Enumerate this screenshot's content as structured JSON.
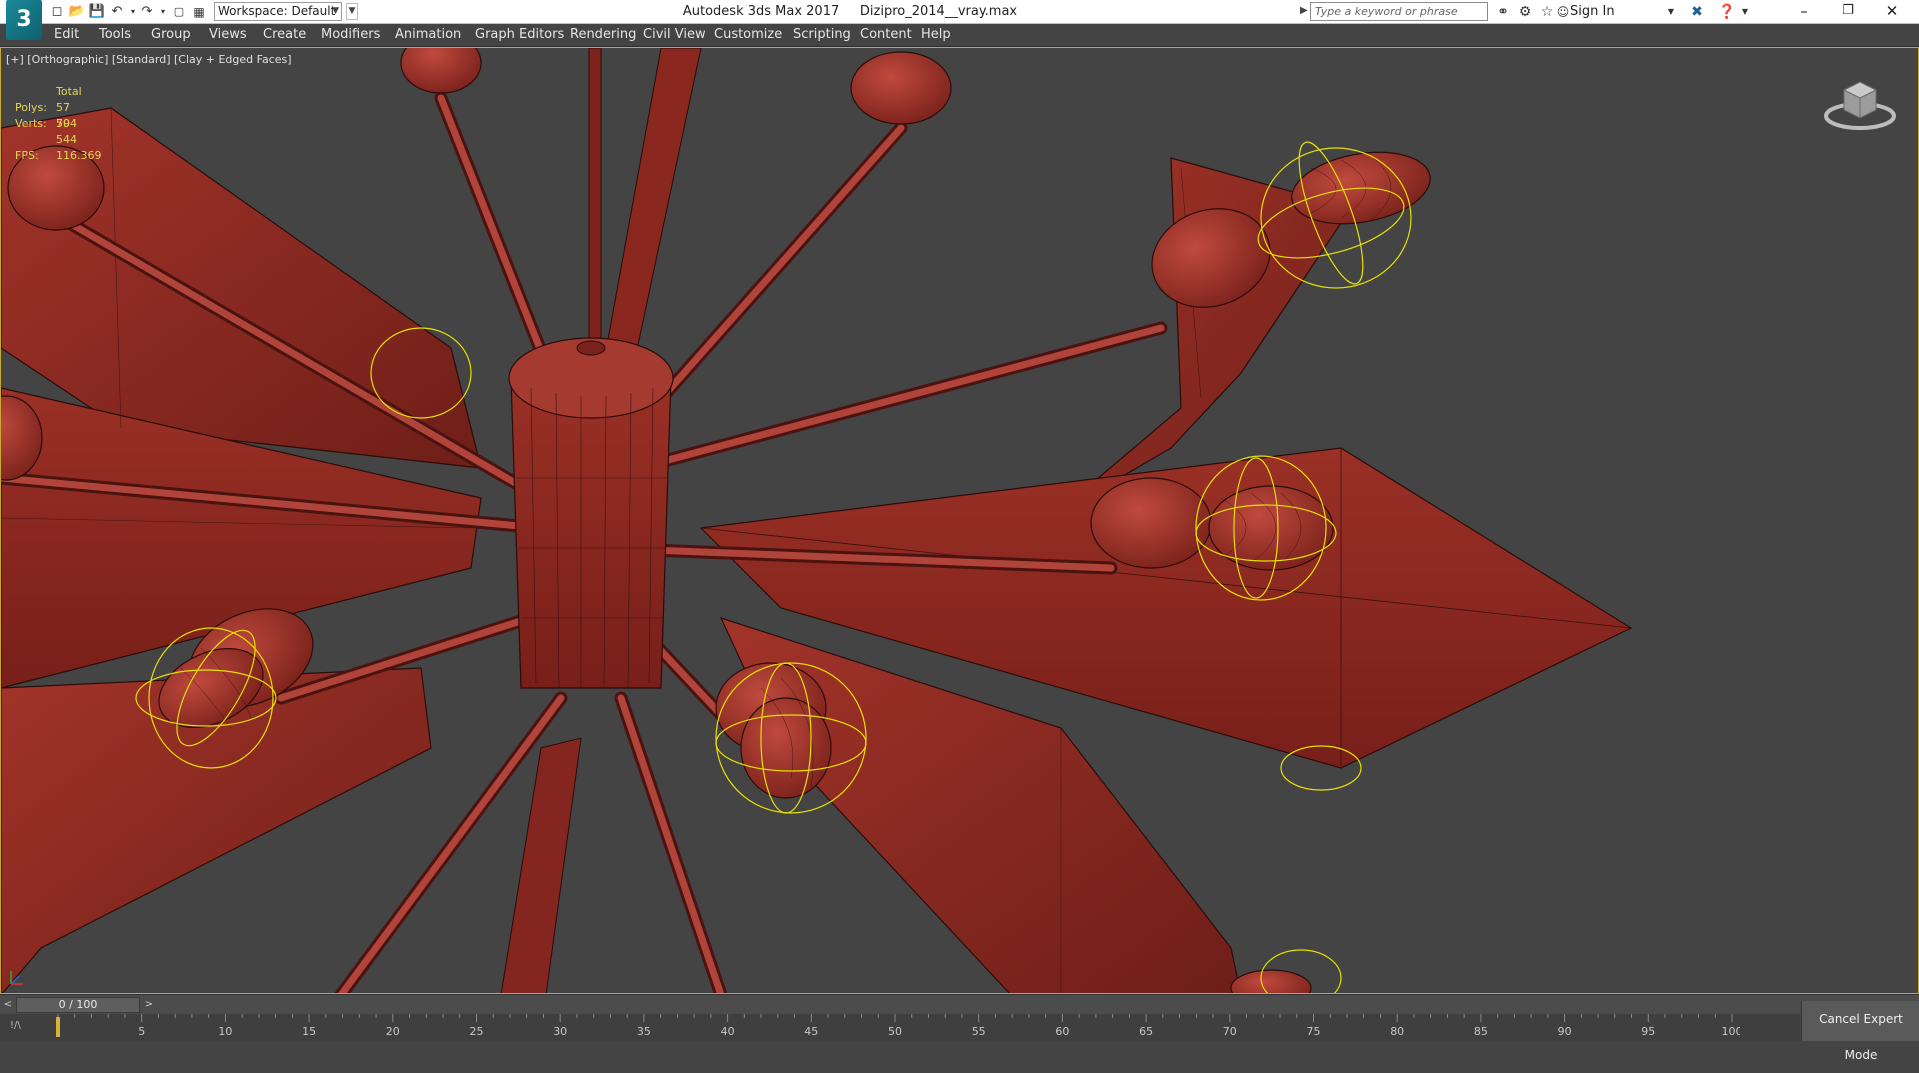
{
  "titlebar": {
    "app_logo": "3",
    "workspace_label": "Workspace: Default",
    "title": "Autodesk 3ds Max 2017     Dizipro_2014__vray.max",
    "search_placeholder": "Type a keyword or phrase",
    "sign_in": "Sign In"
  },
  "menubar": {
    "items": [
      "Edit",
      "Tools",
      "Group",
      "Views",
      "Create",
      "Modifiers",
      "Animation",
      "Graph Editors",
      "Rendering",
      "Civil View",
      "Customize",
      "Scripting",
      "Content",
      "Help"
    ]
  },
  "viewport": {
    "label": "[+] [Orthographic] [Standard] [Clay + Edged Faces]",
    "stats": {
      "header": "Total",
      "polys_label": "Polys:",
      "polys_value": "57 704",
      "verts_label": "Verts:",
      "verts_value": "59 544",
      "fps_label": "FPS:",
      "fps_value": "116.369"
    },
    "model_color": "#8e2a22",
    "selection_color": "#e8e000",
    "frame_color": "#c9a733"
  },
  "timeslider": {
    "frame_readout": "0 / 100",
    "prev_glyph": "<",
    "next_glyph": ">"
  },
  "trackbar": {
    "lead_glyph": "!/\\",
    "tick_labels": [
      "0",
      "5",
      "10",
      "15",
      "20",
      "25",
      "30",
      "35",
      "40",
      "45",
      "50",
      "55",
      "60",
      "65",
      "70",
      "75",
      "80",
      "85",
      "90",
      "95",
      "100"
    ]
  },
  "status": {
    "cancel_expert_mode": "Cancel Expert Mode"
  },
  "icons": {
    "new": "new-file-icon",
    "open": "open-file-icon",
    "save": "save-icon",
    "undo": "undo-icon",
    "redo": "redo-icon",
    "search": "binoculars-icon",
    "star": "star-icon",
    "help": "help-icon",
    "minimize": "minimize-icon",
    "restore": "restore-icon",
    "close": "close-icon"
  }
}
